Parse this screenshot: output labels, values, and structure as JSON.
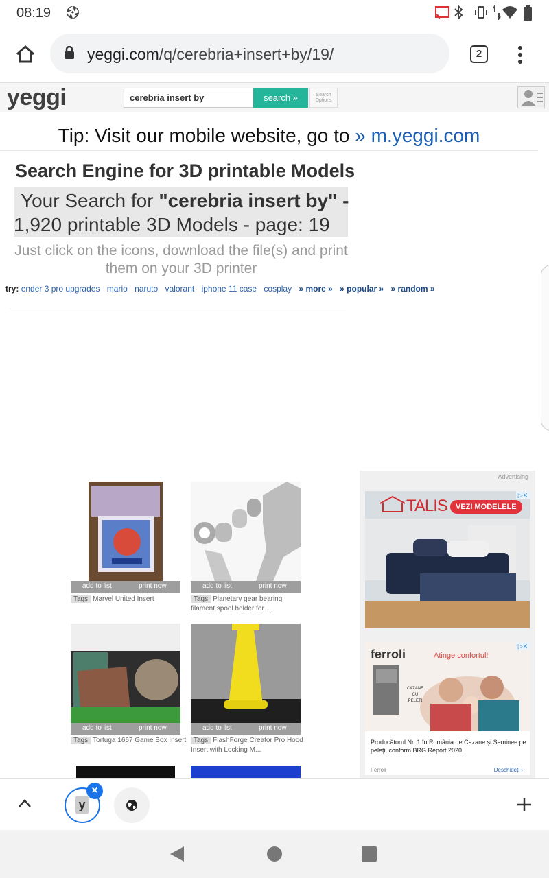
{
  "status": {
    "time": "08:19"
  },
  "browser": {
    "url_domain": "yeggi.com",
    "url_path": "/q/cerebria+insert+by/19/",
    "tab_count": "2"
  },
  "site": {
    "logo": "yeggi",
    "search_value": "cerebria insert by",
    "search_button": "search »",
    "search_options": "Search Options"
  },
  "tip": {
    "text": "Tip: Visit our mobile website, go to ",
    "link": "» m.yeggi.com"
  },
  "heading": "Search Engine for 3D printable Models",
  "result": {
    "prefix": "Your Search for ",
    "quote_open": "\"",
    "query": "cerebria insert by",
    "quote_close": "\" -",
    "line2": "1,920 printable 3D Models - page: 19"
  },
  "subtitle_line1": "Just click on the icons, download the file(s) and print",
  "subtitle_line2": "them on your 3D printer",
  "try": {
    "label": "try:",
    "links": [
      "ender 3 pro upgrades",
      "mario",
      "naruto",
      "valorant",
      "iphone 11 case",
      "cosplay"
    ],
    "bold_links": [
      "» more »",
      "» popular »",
      "» random »"
    ]
  },
  "cards": [
    {
      "add": "add to list",
      "print": "print now",
      "tag": "Tags",
      "title": "Marvel United Insert"
    },
    {
      "add": "add to list",
      "print": "print now",
      "tag": "Tags",
      "title": "Planetary gear bearing filament spool holder for ..."
    },
    {
      "add": "add to list",
      "print": "print now",
      "tag": "Tags",
      "title": "Tortuga 1667 Game Box Insert"
    },
    {
      "add": "add to list",
      "print": "print now",
      "tag": "Tags",
      "title": "FlashForge Creator Pro Hood Insert with Locking M..."
    }
  ],
  "ads": {
    "label": "Advertising",
    "ad1_brand": "TALIS",
    "ad1_cta": "VEZI MODELELE",
    "ad2_brand": "ferroli",
    "ad2_tagline": "Atinge confortul!",
    "ad2_product": "CAZANE CU PELEȚI",
    "ad2_text": "Producătorul Nr. 1 în România de Cazane și Șeminee pe peleți, conform BRG Report 2020.",
    "ad2_source": "Ferroli",
    "ad2_link": "Deschideți"
  },
  "bottom": {
    "tab_letter": "y"
  }
}
